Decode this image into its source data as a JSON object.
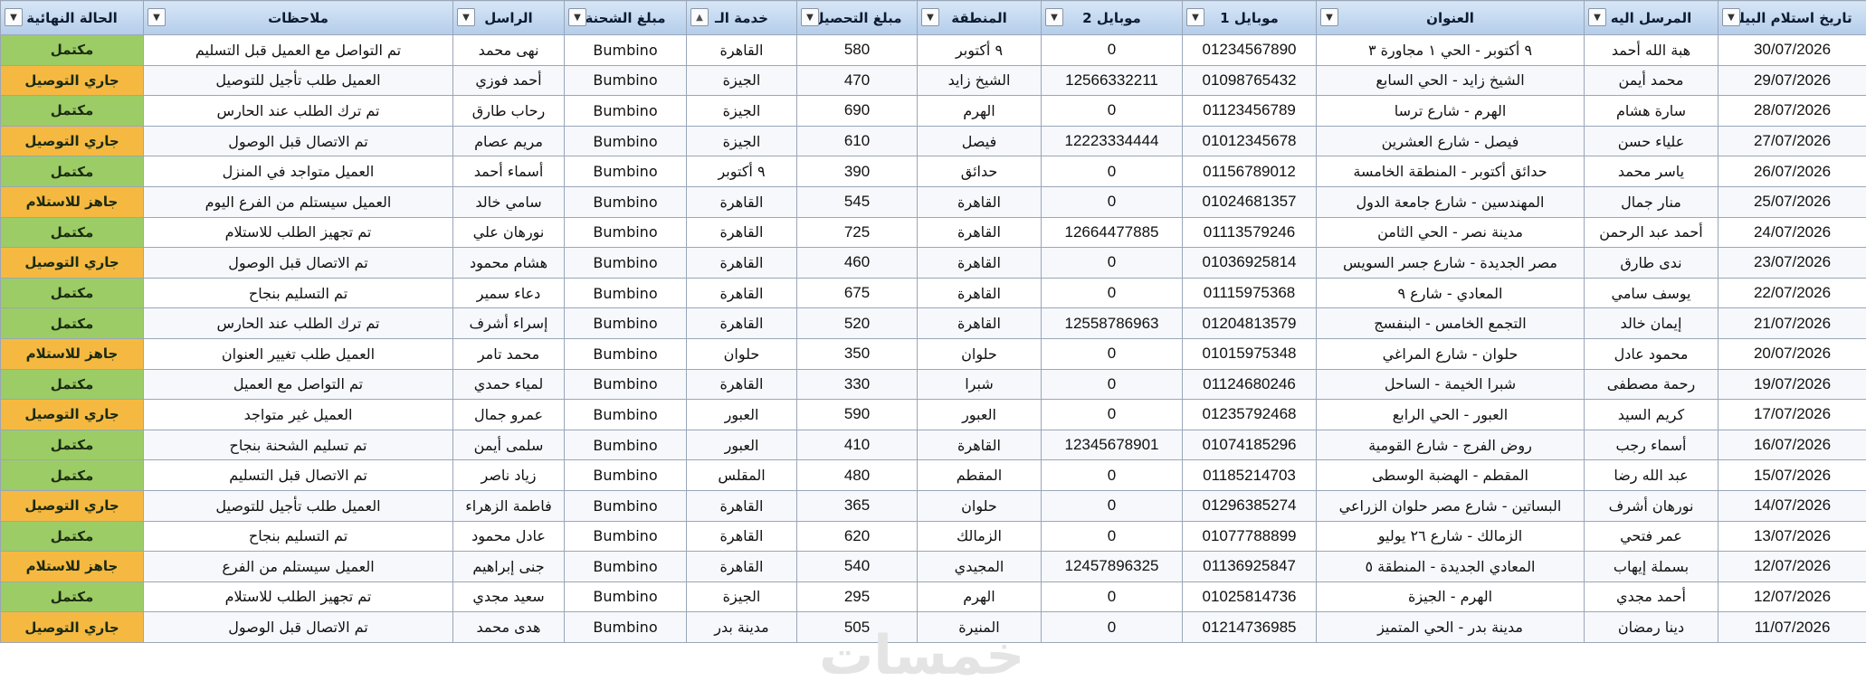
{
  "columns": [
    {
      "label": "تاريخ استلام البيك",
      "width": 164
    },
    {
      "label": "المرسل اليه",
      "width": 148
    },
    {
      "label": "العنوان",
      "width": 296
    },
    {
      "label": "موبايل 1",
      "width": 148
    },
    {
      "label": "موبايل 2",
      "width": 156
    },
    {
      "label": "المنطقة",
      "width": 137
    },
    {
      "label": "مبلغ التحصيل",
      "width": 133
    },
    {
      "label": "خدمة الـ",
      "width": 122
    },
    {
      "label": "مبلغ الشحنة",
      "width": 135
    },
    {
      "label": "الراسل",
      "width": 123
    },
    {
      "label": "ملاحظات",
      "width": 342
    },
    {
      "label": "الحالة النهائية",
      "width": 158
    }
  ],
  "status_colors": {
    "مكتمل": "#9ccc65",
    "جاري التوصيل": "#f5b942",
    "جاهز للاستلام": "#f5b942"
  },
  "rows": [
    [
      "30/07/2026",
      "هبة الله أحمد",
      "٩ أكتوبر - الحي ١ مجاورة ٣",
      "01234567890",
      "0",
      "٩ أكتوبر",
      "580",
      "القاهرة",
      "Bumbino",
      "نهى محمد",
      "تم التواصل مع العميل قبل التسليم",
      "مكتمل"
    ],
    [
      "29/07/2026",
      "محمد أيمن",
      "الشيخ زايد - الحي السابع",
      "01098765432",
      "12566332211",
      "الشيخ زايد",
      "470",
      "الجيزة",
      "Bumbino",
      "أحمد فوزي",
      "العميل طلب تأجيل للتوصيل",
      "جاري التوصيل"
    ],
    [
      "28/07/2026",
      "سارة هشام",
      "الهرم - شارع ترسا",
      "01123456789",
      "0",
      "الهرم",
      "690",
      "الجيزة",
      "Bumbino",
      "رحاب طارق",
      "تم ترك الطلب عند الحارس",
      "مكتمل"
    ],
    [
      "27/07/2026",
      "علياء حسن",
      "فيصل - شارع العشرين",
      "01012345678",
      "12223334444",
      "فيصل",
      "610",
      "الجيزة",
      "Bumbino",
      "مريم عصام",
      "تم الاتصال قبل الوصول",
      "جاري التوصيل"
    ],
    [
      "26/07/2026",
      "ياسر محمد",
      "حدائق أكتوبر - المنطقة الخامسة",
      "01156789012",
      "0",
      "حدائق",
      "390",
      "٩ أكتوبر",
      "Bumbino",
      "أسماء أحمد",
      "العميل متواجد في المنزل",
      "مكتمل"
    ],
    [
      "25/07/2026",
      "منار جمال",
      "المهندسين - شارع جامعة الدول",
      "01024681357",
      "0",
      "القاهرة",
      "545",
      "القاهرة",
      "Bumbino",
      "سامي خالد",
      "العميل سيستلم من الفرع اليوم",
      "جاهز للاستلام"
    ],
    [
      "24/07/2026",
      "أحمد عبد الرحمن",
      "مدينة نصر - الحي الثامن",
      "01113579246",
      "12664477885",
      "القاهرة",
      "725",
      "القاهرة",
      "Bumbino",
      "نورهان علي",
      "تم تجهيز الطلب للاستلام",
      "مكتمل"
    ],
    [
      "23/07/2026",
      "ندى طارق",
      "مصر الجديدة - شارع جسر السويس",
      "01036925814",
      "0",
      "القاهرة",
      "460",
      "القاهرة",
      "Bumbino",
      "هشام محمود",
      "تم الاتصال قبل الوصول",
      "جاري التوصيل"
    ],
    [
      "22/07/2026",
      "يوسف سامي",
      "المعادي - شارع ٩",
      "01115975368",
      "0",
      "القاهرة",
      "675",
      "القاهرة",
      "Bumbino",
      "دعاء سمير",
      "تم التسليم بنجاح",
      "مكتمل"
    ],
    [
      "21/07/2026",
      "إيمان خالد",
      "التجمع الخامس - البنفسج",
      "01204813579",
      "12558786963",
      "القاهرة",
      "520",
      "القاهرة",
      "Bumbino",
      "إسراء أشرف",
      "تم ترك الطلب عند الحارس",
      "مكتمل"
    ],
    [
      "20/07/2026",
      "محمود عادل",
      "حلوان - شارع المراغي",
      "01015975348",
      "0",
      "حلوان",
      "350",
      "حلوان",
      "Bumbino",
      "محمد تامر",
      "العميل طلب تغيير العنوان",
      "جاهز للاستلام"
    ],
    [
      "19/07/2026",
      "رحمة مصطفى",
      "شبرا الخيمة - الساحل",
      "01124680246",
      "0",
      "شبرا",
      "330",
      "القاهرة",
      "Bumbino",
      "لمياء حمدي",
      "تم التواصل مع العميل",
      "مكتمل"
    ],
    [
      "17/07/2026",
      "كريم السيد",
      "العبور - الحي الرابع",
      "01235792468",
      "0",
      "العبور",
      "590",
      "العبور",
      "Bumbino",
      "عمرو جمال",
      "العميل غير متواجد",
      "جاري التوصيل"
    ],
    [
      "16/07/2026",
      "أسماء رجب",
      "روض الفرج - شارع القومية",
      "01074185296",
      "12345678901",
      "القاهرة",
      "410",
      "العبور",
      "Bumbino",
      "سلمى أيمن",
      "تم تسليم الشحنة بنجاح",
      "مكتمل"
    ],
    [
      "15/07/2026",
      "عبد الله رضا",
      "المقطم - الهضبة الوسطى",
      "01185214703",
      "0",
      "المقطم",
      "480",
      "المقلس",
      "Bumbino",
      "زياد ناصر",
      "تم الاتصال قبل التسليم",
      "مكتمل"
    ],
    [
      "14/07/2026",
      "نورهان أشرف",
      "البساتين - شارع مصر حلوان الزراعي",
      "01296385274",
      "0",
      "حلوان",
      "365",
      "القاهرة",
      "Bumbino",
      "فاطمة الزهراء",
      "العميل طلب تأجيل للتوصيل",
      "جاري التوصيل"
    ],
    [
      "13/07/2026",
      "عمر فتحي",
      "الزمالك - شارع ٢٦ يوليو",
      "01077788899",
      "0",
      "الزمالك",
      "620",
      "القاهرة",
      "Bumbino",
      "عادل محمود",
      "تم التسليم بنجاح",
      "مكتمل"
    ],
    [
      "12/07/2026",
      "بسملة إيهاب",
      "المعادي الجديدة - المنطقة ٥",
      "01136925847",
      "12457896325",
      "المجيدي",
      "540",
      "القاهرة",
      "Bumbino",
      "جنى إبراهيم",
      "العميل سيستلم من الفرع",
      "جاهز للاستلام"
    ],
    [
      "12/07/2026",
      "أحمد مجدي",
      "الهرم - الجيزة",
      "01025814736",
      "0",
      "الهرم",
      "295",
      "الجيزة",
      "Bumbino",
      "سعيد مجدي",
      "تم تجهيز الطلب للاستلام",
      "مكتمل"
    ],
    [
      "11/07/2026",
      "دينا رمضان",
      "مدينة بدر - الحي المتميز",
      "01214736985",
      "0",
      "المنيرة",
      "505",
      "مدينة بدر",
      "Bumbino",
      "هدى محمد",
      "تم الاتصال قبل الوصول",
      "جاري التوصيل"
    ]
  ],
  "watermark": "خمسات"
}
